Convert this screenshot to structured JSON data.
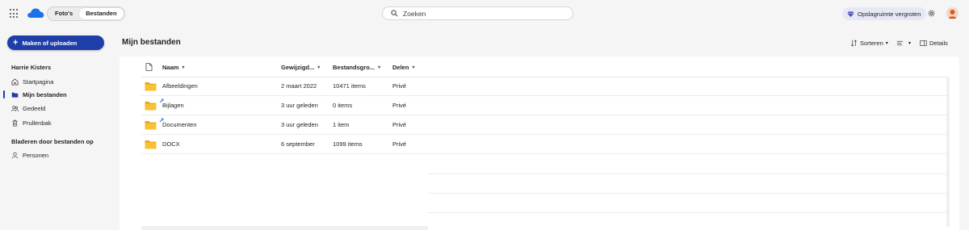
{
  "topbar": {
    "tabs": [
      {
        "label": "Foto's",
        "active": false
      },
      {
        "label": "Bestanden",
        "active": true
      }
    ],
    "search_placeholder": "Zoeken",
    "upgrade_label": "Opslagruimte vergroten"
  },
  "sidebar": {
    "create_button": "Maken of uploaden",
    "user_name": "Harrie Kisters",
    "items": [
      {
        "label": "Startpagina",
        "icon": "home-icon"
      },
      {
        "label": "Mijn bestanden",
        "icon": "folder-icon",
        "active": true
      },
      {
        "label": "Gedeeld",
        "icon": "people-icon"
      },
      {
        "label": "Prullenbak",
        "icon": "trash-icon"
      }
    ],
    "browse_heading": "Bladeren door bestanden op",
    "browse_items": [
      {
        "label": "Personen",
        "icon": "person-icon"
      }
    ]
  },
  "main": {
    "title": "Mijn bestanden",
    "commands": {
      "sort": "Sorteren",
      "details": "Details"
    },
    "columns": {
      "name": "Naam",
      "modified": "Gewijzigd...",
      "size": "Bestandsgro...",
      "sharing": "Delen"
    },
    "rows": [
      {
        "name": "Afbeeldingen",
        "modified": "2 maart 2022",
        "size": "10471 items",
        "sharing": "Privé",
        "shared_mark": false
      },
      {
        "name": "Bijlagen",
        "modified": "3 uur geleden",
        "size": "0 items",
        "sharing": "Privé",
        "shared_mark": true
      },
      {
        "name": "Documenten",
        "modified": "3 uur geleden",
        "size": "1 item",
        "sharing": "Privé",
        "shared_mark": true
      },
      {
        "name": "DOCX",
        "modified": "6 september",
        "size": "1099 items",
        "sharing": "Privé",
        "shared_mark": false
      }
    ]
  },
  "colors": {
    "accent": "#1f3fa8",
    "folder": "#f7c233",
    "upgrade_bg": "#e6e8f5"
  }
}
